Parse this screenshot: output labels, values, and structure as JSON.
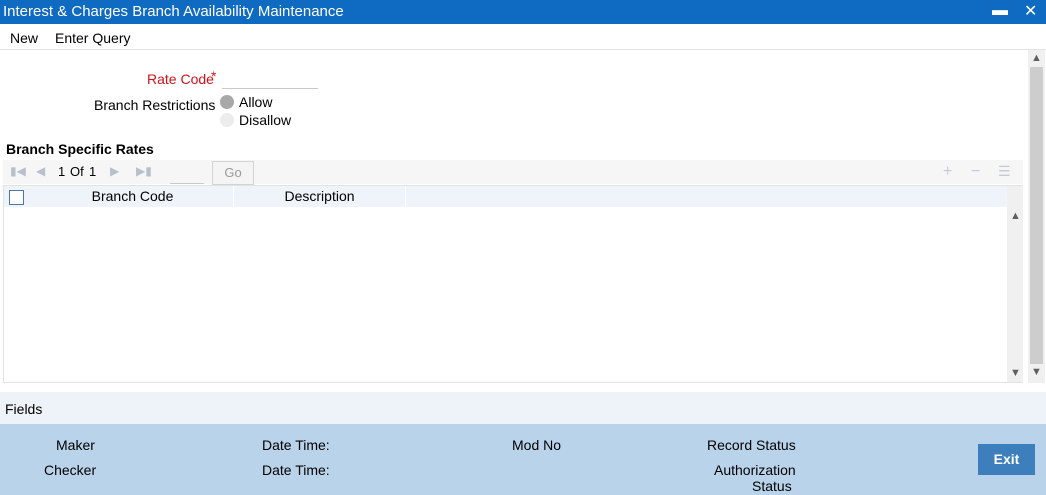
{
  "window": {
    "title": "Interest & Charges Branch Availability Maintenance",
    "minimize": "▬",
    "close": "✕"
  },
  "menu": {
    "new": "New",
    "enter_query": "Enter Query"
  },
  "form": {
    "rate_code_label": "Rate Code",
    "required_mark": "*",
    "rate_code_value": "",
    "branch_restrictions_label": "Branch Restrictions",
    "allow_label": "Allow",
    "disallow_label": "Disallow"
  },
  "grid": {
    "section_title": "Branch Specific Rates",
    "pager": {
      "current": "1",
      "of_label": "Of",
      "total": "1",
      "go_label": "Go"
    },
    "columns": [
      "Branch Code",
      "Description"
    ],
    "rows": []
  },
  "fields_bar": {
    "label": "Fields"
  },
  "footer": {
    "maker": "Maker",
    "checker": "Checker",
    "date_time_1": "Date Time:",
    "date_time_2": "Date Time:",
    "mod_no": "Mod No",
    "record_status": "Record Status",
    "authorization": "Authorization",
    "authorization_status": "Status",
    "exit_label": "Exit"
  },
  "colors": {
    "titlebar": "#0f6ac2",
    "footer": "#b9d3ea",
    "exit_button": "#3d7fbd",
    "required": "#d0121a"
  }
}
